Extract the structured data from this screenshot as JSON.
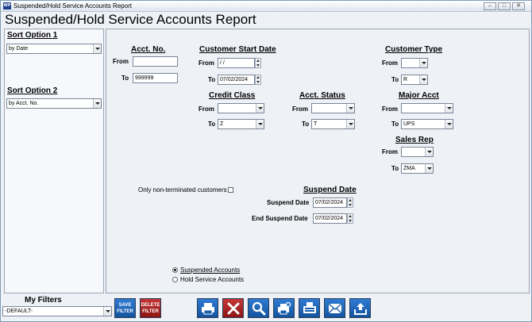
{
  "window": {
    "caption": "Suspended/Hold Service Accounts Report",
    "report_title": "Suspended/Hold Service Accounts Report",
    "app_icon_text": "WP"
  },
  "sidebar": {
    "sort1_label": "Sort Option 1",
    "sort1_value": "by Date",
    "sort2_label": "Sort Option 2",
    "sort2_value": "by Acct. No."
  },
  "acct_no": {
    "header": "Acct. No.",
    "from_label": "From",
    "from_value": "",
    "to_label": "To",
    "to_value": "999999"
  },
  "customer_start_date": {
    "header": "Customer Start Date",
    "from_label": "From",
    "from_value": " / /",
    "to_label": "To",
    "to_value": "07/02/2024"
  },
  "customer_type": {
    "header": "Customer Type",
    "from_label": "From",
    "from_value": "",
    "to_label": "To",
    "to_value": "R"
  },
  "credit_class": {
    "header": "Credit Class",
    "from_label": "From",
    "from_value": "",
    "to_label": "To",
    "to_value": "Z"
  },
  "acct_status": {
    "header": "Acct. Status",
    "from_label": "From",
    "from_value": "",
    "to_label": "To",
    "to_value": "T"
  },
  "major_acct": {
    "header": "Major Acct",
    "from_label": "From",
    "from_value": "",
    "to_label": "To",
    "to_value": "UPS"
  },
  "sales_rep": {
    "header": "Sales Rep",
    "from_label": "From",
    "from_value": "",
    "to_label": "To",
    "to_value": "ZMA"
  },
  "options": {
    "non_terminated_label": "Only non-terminated customers"
  },
  "suspend_date": {
    "header": "Suspend Date",
    "start_label": "Suspend Date",
    "start_value": "07/02/2024",
    "end_label": "End Suspend Date",
    "end_value": "07/02/2024"
  },
  "account_kind": {
    "suspended_label": "Suspended Accounts",
    "hold_label": "Hold Service Accounts",
    "selected": "Suspended Accounts"
  },
  "footer": {
    "my_filters_label": "My Filters",
    "filter_value": "-DEFAULT-",
    "save_filter_line1": "SAVE",
    "save_filter_line2": "FILTER",
    "delete_filter_line1": "DELETE",
    "delete_filter_line2": "FILTER"
  },
  "toolbar_icons": [
    "print-icon",
    "close-x-icon",
    "search-icon",
    "print-preview-icon",
    "fax-icon",
    "email-icon",
    "export-icon"
  ],
  "colors": {
    "button_blue": "#1f63b8",
    "button_red": "#a52020"
  }
}
